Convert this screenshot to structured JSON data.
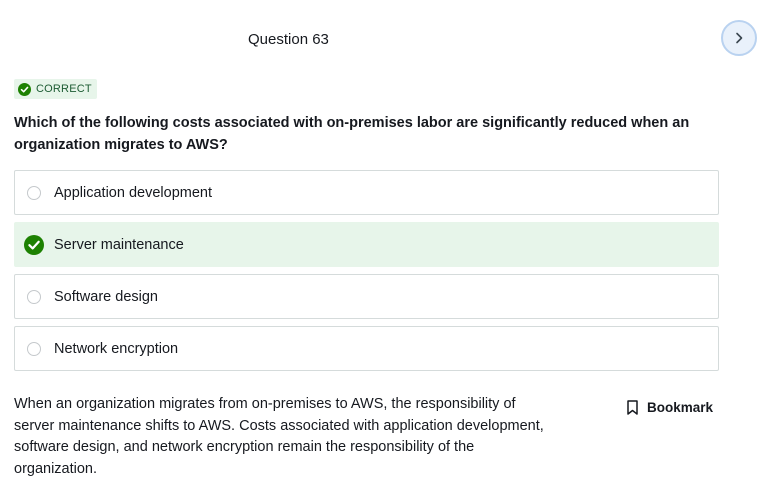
{
  "header": {
    "question_title": "Question 63",
    "next_icon": "chevron-right-icon"
  },
  "status": {
    "badge_text": "CORRECT",
    "badge_icon": "check-circle-icon",
    "color": "#1d8102"
  },
  "question": {
    "text": "Which of the following costs associated with on-premises labor are significantly reduced when an organization migrates to AWS?"
  },
  "options": [
    {
      "label": "Application development",
      "selected": false
    },
    {
      "label": "Server maintenance",
      "selected": true
    },
    {
      "label": "Software design",
      "selected": false
    },
    {
      "label": "Network encryption",
      "selected": false
    }
  ],
  "explanation": {
    "text": "When an organization migrates from on-premises to AWS, the responsibility of server maintenance shifts to AWS. Costs associated with application development, software design, and network encryption remain the responsibility of the organization."
  },
  "bookmark": {
    "label": "Bookmark",
    "icon": "bookmark-icon"
  },
  "colors": {
    "accent_green": "#1d8102",
    "selected_bg": "#e7f5ea",
    "next_button_bg": "#e9f1fb",
    "next_button_border": "#b9d2f0"
  }
}
